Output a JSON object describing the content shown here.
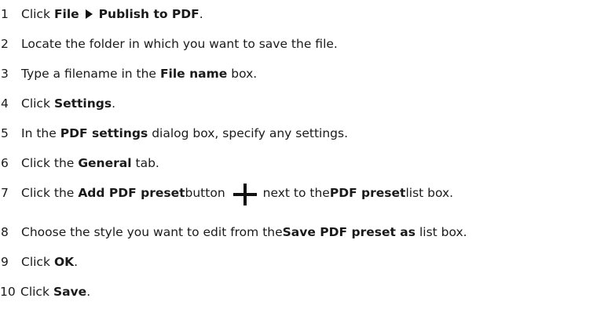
{
  "steps": [
    {
      "num": "1",
      "parts": [
        "Click ",
        "File",
        " ",
        "Publish to PDF",
        "."
      ]
    },
    {
      "num": "2",
      "text": "Locate the folder in which you want to save the file."
    },
    {
      "num": "3",
      "parts": [
        "Type a filename in the ",
        "File name",
        " box."
      ]
    },
    {
      "num": "4",
      "parts": [
        "Click ",
        "Settings",
        "."
      ]
    },
    {
      "num": "5",
      "parts": [
        "In the ",
        "PDF settings",
        " dialog box, specify any settings."
      ]
    },
    {
      "num": "6",
      "parts": [
        "Click the ",
        "General",
        " tab."
      ]
    },
    {
      "num": "7",
      "parts": [
        "Click the ",
        "Add PDF preset",
        " button",
        "next to the ",
        "PDF preset",
        " list box."
      ]
    },
    {
      "num": "8",
      "parts": [
        "Choose the style you want to edit from the ",
        "Save PDF preset as",
        " list box."
      ]
    },
    {
      "num": "9",
      "parts": [
        "Click ",
        "OK",
        "."
      ]
    },
    {
      "num": "10",
      "parts": [
        "Click ",
        "Save",
        "."
      ]
    }
  ],
  "icons": {
    "menu_arrow": "triangle-right-icon",
    "add_preset": "plus-icon"
  }
}
